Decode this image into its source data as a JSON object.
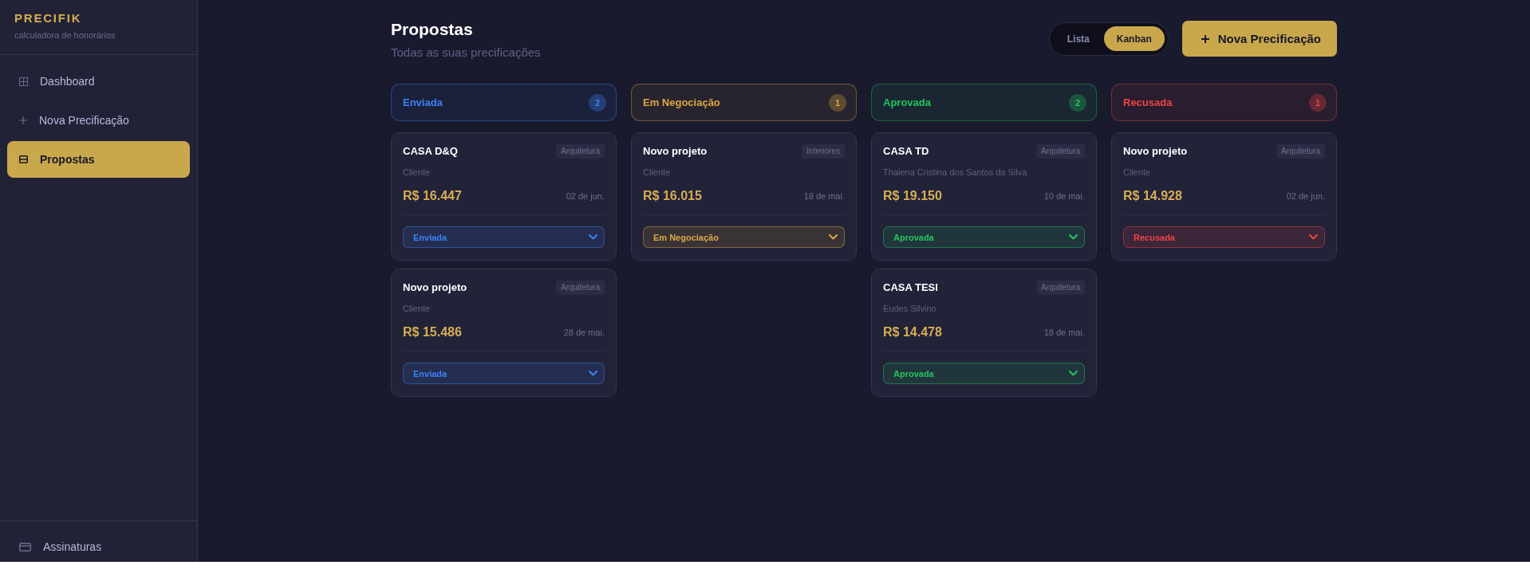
{
  "sidebar": {
    "logo": "PRECIFIK",
    "tagline": "calculadora de honorários",
    "items": [
      {
        "label": "Dashboard",
        "selected": false
      },
      {
        "label": "Nova Precificação",
        "selected": false
      },
      {
        "label": "Propostas",
        "selected": true
      }
    ],
    "footer_items": [
      {
        "label": "Assinaturas",
        "selected": false
      }
    ]
  },
  "header": {
    "title": "Propostas",
    "subtitle": "Todas as suas precificações",
    "view_toggle": [
      {
        "label": "Lista",
        "selected": false
      },
      {
        "label": "Kanban",
        "selected": true
      }
    ],
    "new_button": {
      "label": "Nova Precificação"
    }
  },
  "columns": [
    {
      "title": "Enviada",
      "count": "2",
      "color": "#3b82f6",
      "cards": [
        {
          "title": "CASA D&Q",
          "tag": "Arquitetura",
          "client": "Cliente",
          "price": "R$ 16.447",
          "date": "02 de jun.",
          "status": "Enviada"
        },
        {
          "title": "Novo projeto",
          "tag": "Arquitetura",
          "client": "Cliente",
          "price": "R$ 15.486",
          "date": "28 de mai.",
          "status": "Enviada"
        }
      ]
    },
    {
      "title": "Em Negociação",
      "count": "1",
      "color": "#dba840",
      "cards": [
        {
          "title": "Novo projeto",
          "tag": "Interiores",
          "client": "Cliente",
          "price": "R$ 16.015",
          "date": "18 de mai.",
          "status": "Em Negociação"
        }
      ]
    },
    {
      "title": "Aprovada",
      "count": "2",
      "color": "#22c55e",
      "cards": [
        {
          "title": "CASA TD",
          "tag": "Arquitetura",
          "client": "Thaiena Cristina dos Santos da Silva",
          "price": "R$ 19.150",
          "date": "10 de mai.",
          "status": "Aprovada"
        },
        {
          "title": "CASA TESI",
          "tag": "Arquitetura",
          "client": "Eudes Silvino",
          "price": "R$ 14.478",
          "date": "18 de mai.",
          "status": "Aprovada"
        }
      ]
    },
    {
      "title": "Recusada",
      "count": "1",
      "color": "#ef4444",
      "cards": [
        {
          "title": "Novo projeto",
          "tag": "Arquitetura",
          "client": "Cliente",
          "price": "R$ 14.928",
          "date": "02 de jun.",
          "status": "Recusada"
        }
      ]
    }
  ]
}
